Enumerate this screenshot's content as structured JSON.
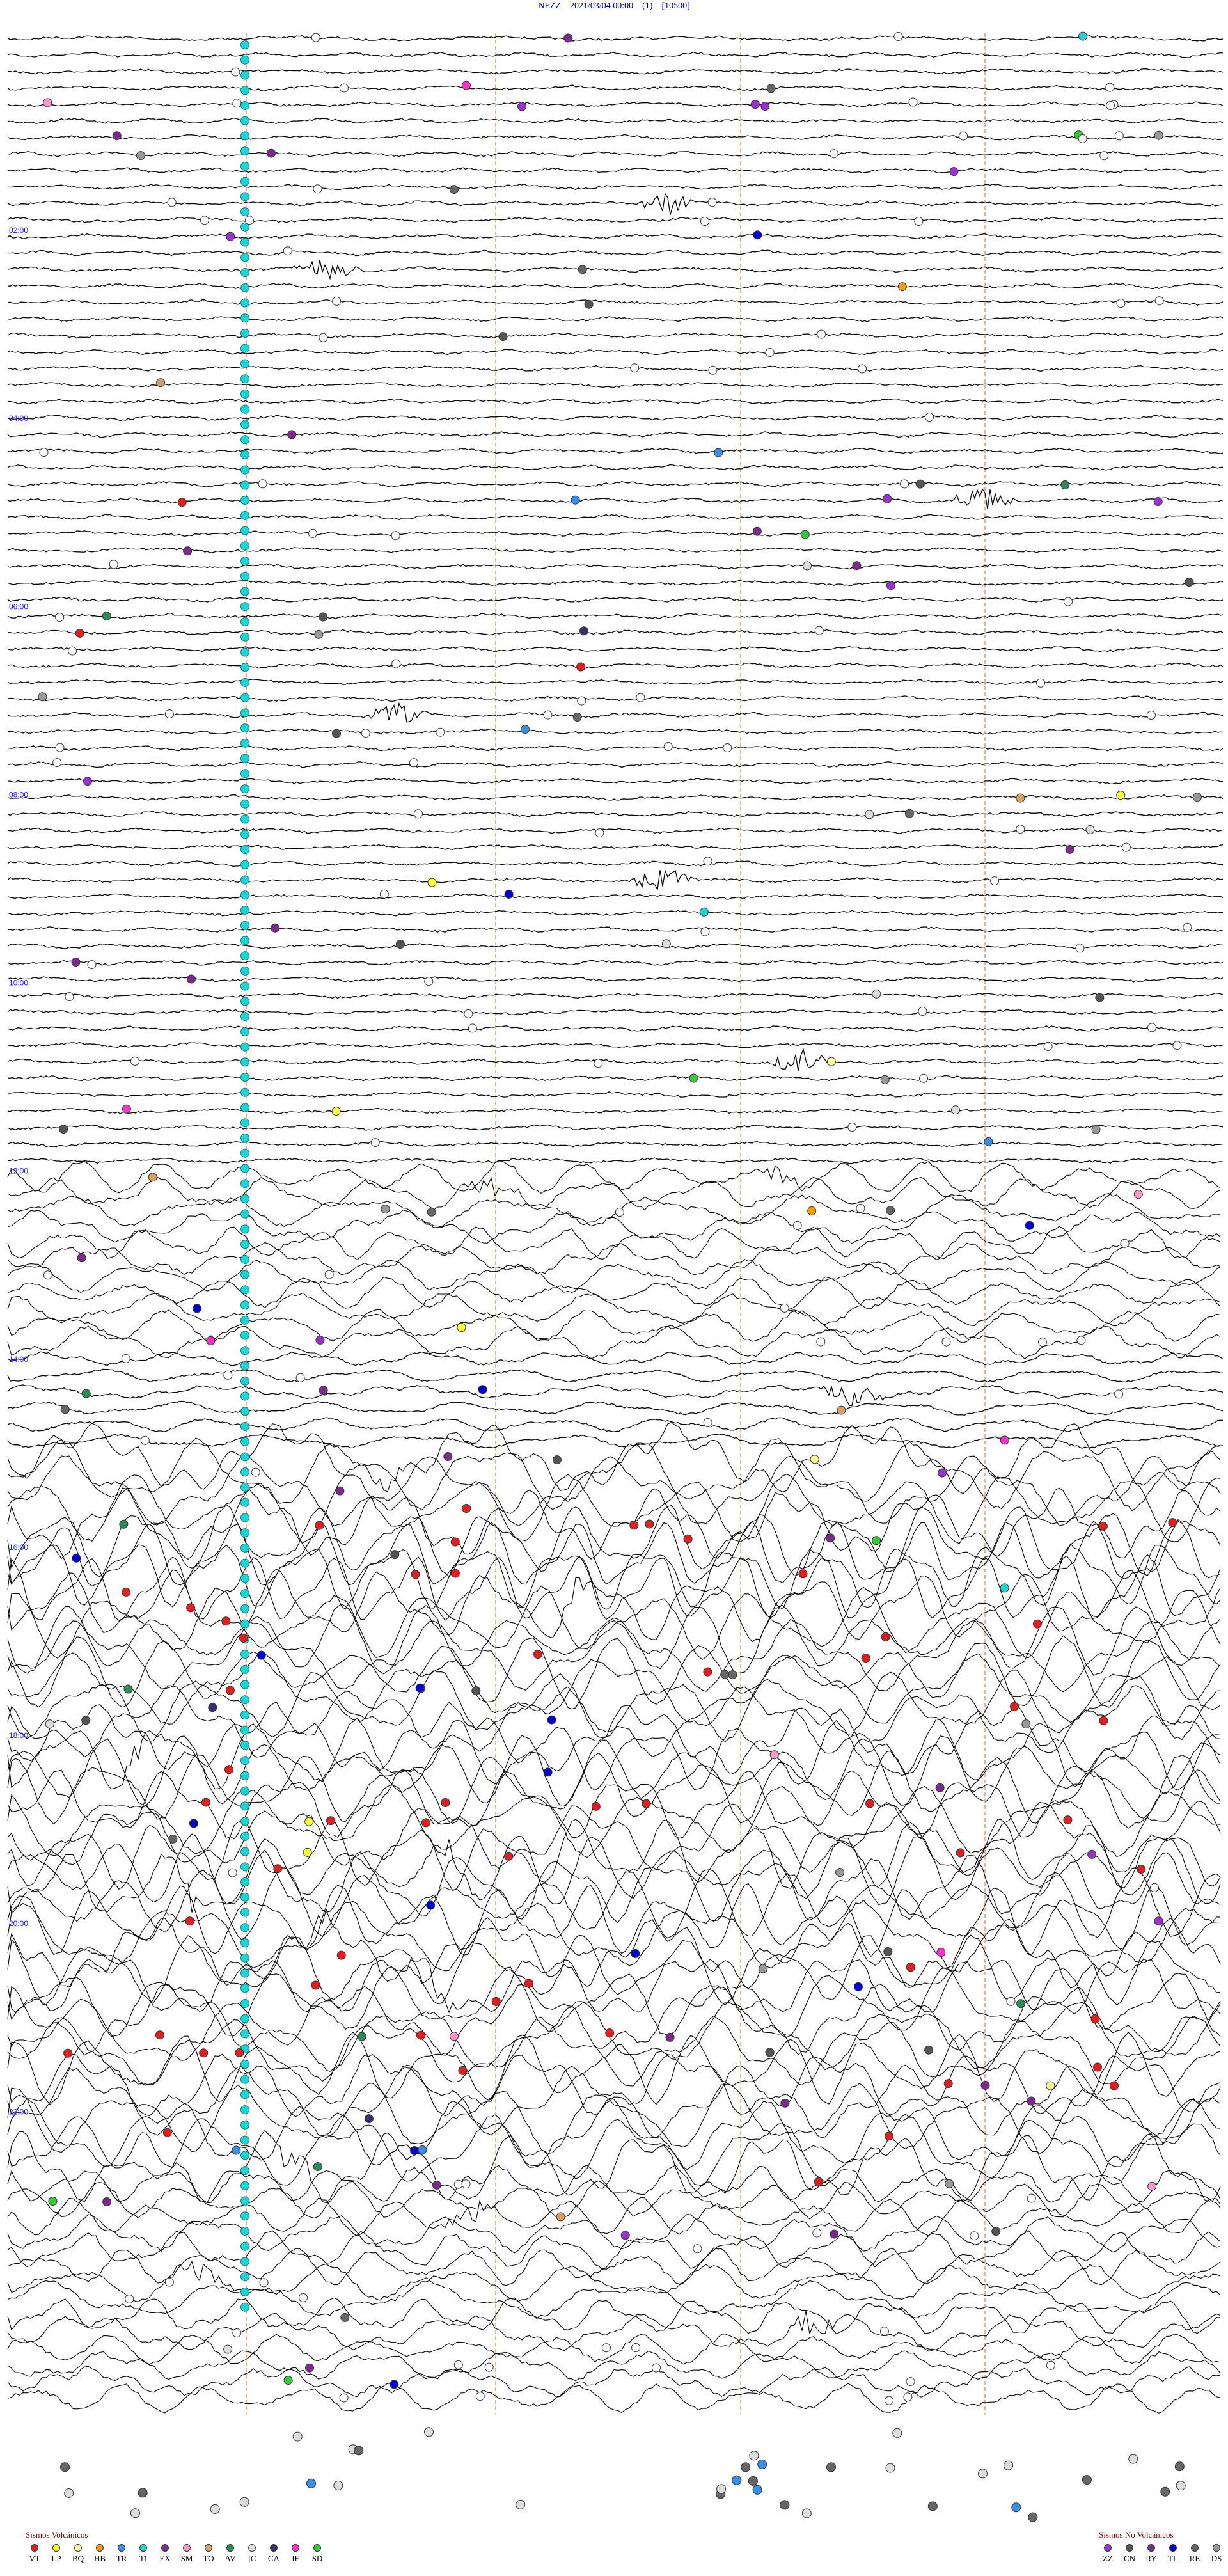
{
  "header": {
    "title": "NEZZ    2021/03/04 00:00    (1)    [10500]"
  },
  "chart_data": {
    "type": "line",
    "title": "NEZZ    2021/03/04 00:00    (1)    [10500]",
    "station": "NEZZ",
    "start_datetime": "2021/03/04 00:00",
    "hour_labels": [
      "02:00",
      "04:00",
      "06:00",
      "08:00",
      "10:00",
      "12:00",
      "14:00",
      "16:00",
      "18:00",
      "20:00",
      "22:00"
    ],
    "colors": {
      "trace": "#000000",
      "hour_label": "#1a1aff",
      "marker_line": "#e07a3a",
      "cyan_column": "#22d3d3"
    },
    "legend_volcanic": {
      "title": "Sismos Volcánicos",
      "items": [
        {
          "code": "VT",
          "color": "#e02020"
        },
        {
          "code": "LP",
          "color": "#ffff33"
        },
        {
          "code": "BQ",
          "color": "#ffff99"
        },
        {
          "code": "HB",
          "color": "#ff9900"
        },
        {
          "code": "TR",
          "color": "#3a8ee6"
        },
        {
          "code": "TI",
          "color": "#22d3d3"
        },
        {
          "code": "EX",
          "color": "#7a2b8c"
        },
        {
          "code": "SM",
          "color": "#ff99cc"
        },
        {
          "code": "TO",
          "color": "#d9a066"
        },
        {
          "code": "AV",
          "color": "#2e8b57"
        },
        {
          "code": "IC",
          "color": "#dddddd"
        },
        {
          "code": "CA",
          "color": "#3b2f6b"
        },
        {
          "code": "IF",
          "color": "#ff33cc"
        },
        {
          "code": "SD",
          "color": "#33cc33"
        }
      ]
    },
    "legend_nonvolcanic": {
      "title": "Sismos No Volcánicos",
      "items": [
        {
          "code": "ZZ",
          "color": "#9933cc"
        },
        {
          "code": "CN",
          "color": "#555555"
        },
        {
          "code": "RY",
          "color": "#7a2b8c"
        },
        {
          "code": "TL",
          "color": "#0000cc"
        },
        {
          "code": "RE",
          "color": "#666666"
        },
        {
          "code": "DS",
          "color": "#999999"
        }
      ]
    }
  }
}
